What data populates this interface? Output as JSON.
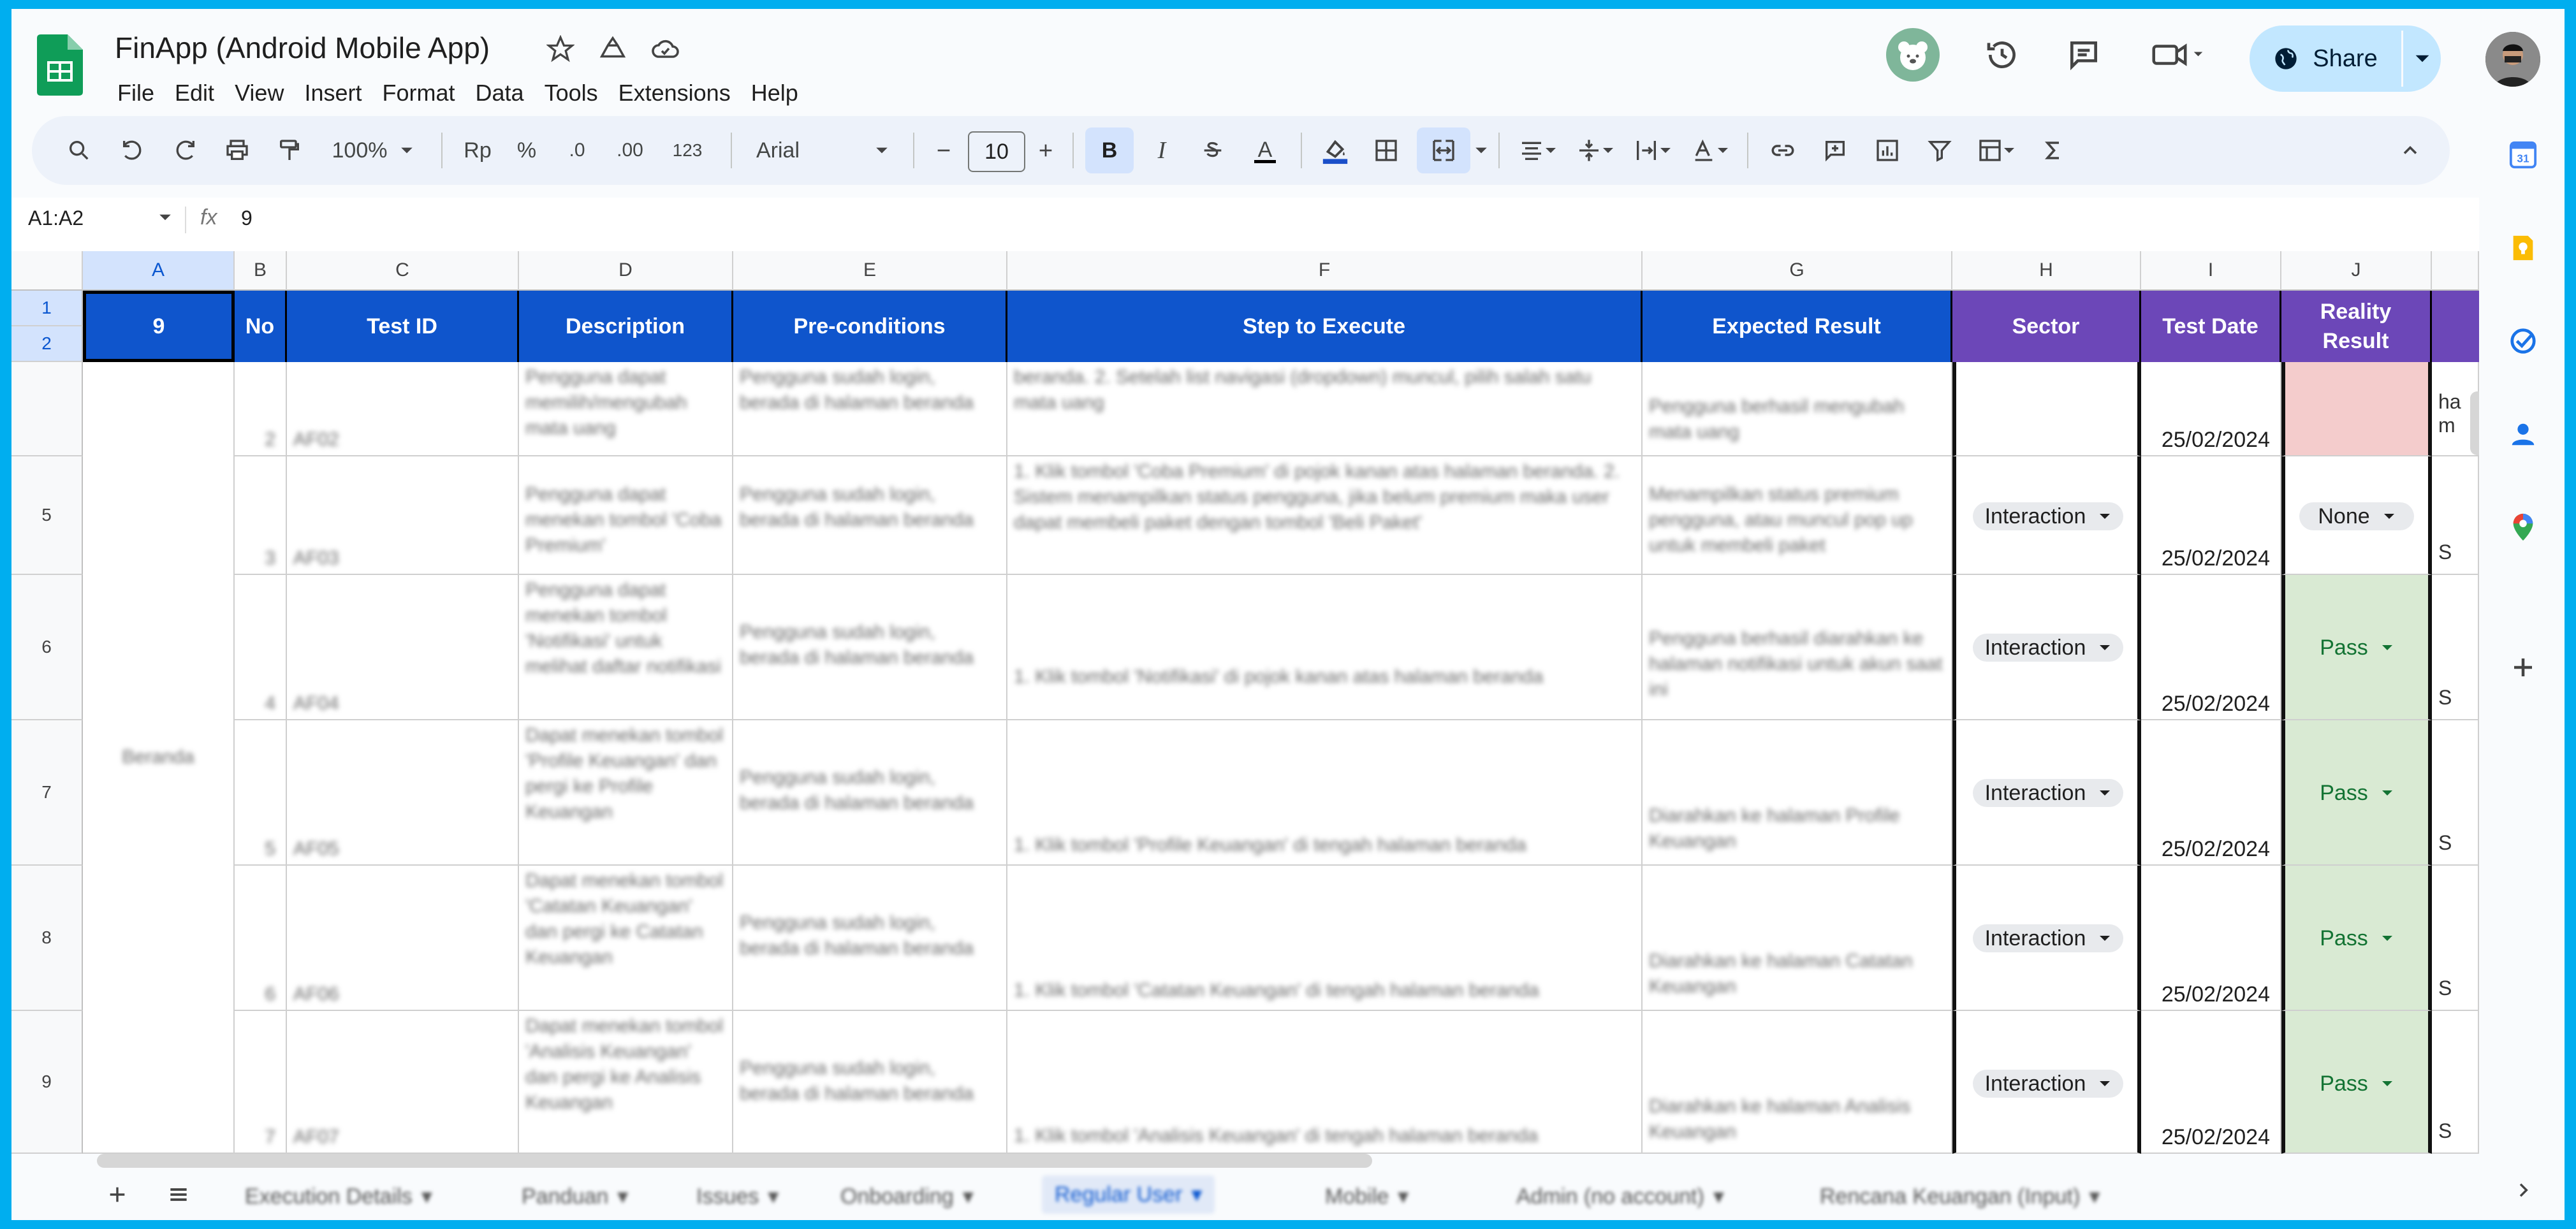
{
  "doc": {
    "title": "FinApp (Android Mobile App)"
  },
  "menu": [
    "File",
    "Edit",
    "View",
    "Insert",
    "Format",
    "Data",
    "Tools",
    "Extensions",
    "Help"
  ],
  "share": {
    "label": "Share"
  },
  "toolbar": {
    "zoom": "100%",
    "currency": "Rp",
    "percent": "%",
    "dec_minus": ".0",
    "dec_plus": ".00",
    "format_123": "123",
    "font": "Arial",
    "font_size": "10",
    "bold": "B",
    "italic": "I",
    "text_color": "A"
  },
  "formula_bar": {
    "range": "A1:A2",
    "fx": "fx",
    "value": "9"
  },
  "columns": [
    "A",
    "B",
    "C",
    "D",
    "E",
    "F",
    "G",
    "H",
    "I",
    "J"
  ],
  "rows": [
    "1",
    "2",
    "5",
    "6",
    "7",
    "8",
    "9"
  ],
  "header": {
    "a": "9",
    "no": "No",
    "test_id": "Test ID",
    "description": "Description",
    "preconditions": "Pre-conditions",
    "steps": "Step to Execute",
    "expected": "Expected Result",
    "sector": "Sector",
    "test_date": "Test Date",
    "reality_1": "Reality",
    "reality_2": "Result"
  },
  "data_rows": [
    {
      "no": "2",
      "id": "AF02",
      "desc": "Pengguna dapat memilih/mengubah mata uang",
      "pre": "Pengguna sudah login, berada di halaman beranda",
      "step": "beranda. 2. Setelah list navigasi (dropdown) muncul, pilih salah satu mata uang",
      "exp": "Pengguna berhasil mengubah mata uang",
      "sector": "",
      "date": "25/02/2024",
      "reality": "",
      "k": "ha m"
    },
    {
      "no": "3",
      "id": "AF03",
      "desc": "Pengguna dapat menekan tombol 'Coba Premium'",
      "pre": "Pengguna sudah login, berada di halaman beranda",
      "step": "1. Klik tombol 'Coba Premium' di pojok kanan atas halaman beranda. 2. Sistem menampilkan status pengguna, jika belum premium maka user dapat membeli paket dengan tombol 'Beli Paket'",
      "exp": "Menampilkan status premium pengguna, atau muncul pop up untuk membeli paket",
      "sector": "Interaction",
      "date": "25/02/2024",
      "reality": "None",
      "k": "S"
    },
    {
      "no": "4",
      "id": "AF04",
      "desc": "Pengguna dapat menekan tombol 'Notifikasi' untuk melihat daftar notifikasi",
      "pre": "Pengguna sudah login, berada di halaman beranda",
      "step": "1. Klik tombol 'Notifikasi' di pojok kanan atas halaman beranda",
      "exp": "Pengguna berhasil diarahkan ke halaman notifikasi untuk akun saat ini",
      "sector": "Interaction",
      "date": "25/02/2024",
      "reality": "Pass",
      "k": "S"
    },
    {
      "no": "5",
      "id": "AF05",
      "desc": "Dapat menekan tombol 'Profile Keuangan' dan pergi ke Profile Keuangan",
      "pre": "Pengguna sudah login, berada di halaman beranda",
      "step": "1. Klik tombol 'Profile Keuangan' di tengah halaman beranda",
      "exp": "Diarahkan ke halaman Profile Keuangan",
      "sector": "Interaction",
      "date": "25/02/2024",
      "reality": "Pass",
      "k": "S"
    },
    {
      "no": "6",
      "id": "AF06",
      "desc": "Dapat menekan tombol 'Catatan Keuangan' dan pergi ke Catatan Keuangan",
      "pre": "Pengguna sudah login, berada di halaman beranda",
      "step": "1. Klik tombol 'Catatan Keuangan' di tengah halaman beranda",
      "exp": "Diarahkan ke halaman Catatan Keuangan",
      "sector": "Interaction",
      "date": "25/02/2024",
      "reality": "Pass",
      "k": "S"
    },
    {
      "no": "7",
      "id": "AF07",
      "desc": "Dapat menekan tombol 'Analisis Keuangan' dan pergi ke Analisis Keuangan",
      "pre": "Pengguna sudah login, berada di halaman beranda",
      "step": "1. Klik tombol 'Analisis Keuangan' di tengah halaman beranda",
      "exp": "Diarahkan ke halaman Analisis Keuangan",
      "sector": "Interaction",
      "date": "25/02/2024",
      "reality": "Pass",
      "k": "S"
    }
  ],
  "merged_a": "Beranda",
  "sheets": [
    {
      "label": "Execution Details"
    },
    {
      "label": "Panduan"
    },
    {
      "label": "Issues"
    },
    {
      "label": "Onboarding"
    },
    {
      "label": "Regular User"
    },
    {
      "label": "Mobile"
    },
    {
      "label": "Admin (no account)"
    },
    {
      "label": "Rencana Keuangan (Input)"
    }
  ],
  "colors": {
    "header_blue": "#0F55CC",
    "header_purple": "#6C47B8",
    "pass_fill": "#D9EAD3",
    "pink_fill": "#F4CCCC",
    "frame": "#00AEEF"
  },
  "side_icons": [
    "calendar-icon",
    "keep-icon",
    "tasks-icon",
    "contacts-icon",
    "maps-icon",
    "add-icon"
  ]
}
